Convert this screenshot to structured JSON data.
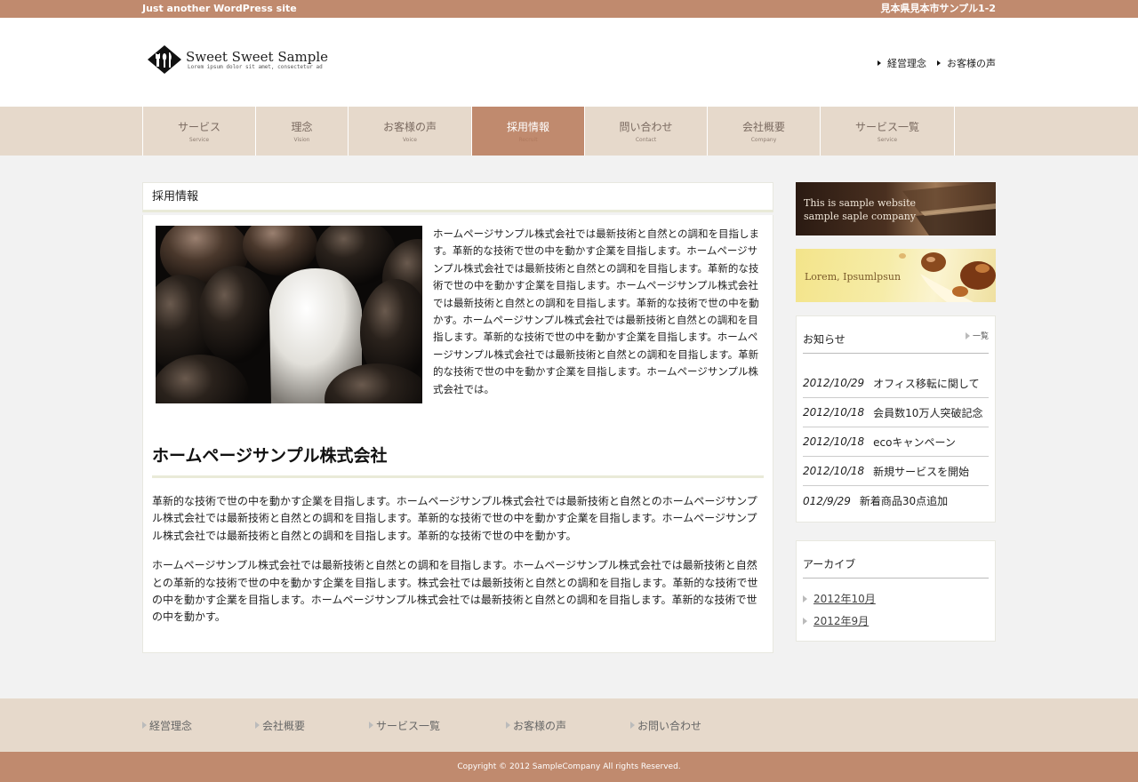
{
  "topbar": {
    "tagline": "Just another WordPress site",
    "address": "見本県見本市サンプル1-2"
  },
  "logo": {
    "title": "Sweet Sweet Sample",
    "subtitle": "Lorem ipsum dolor sit amet, consectetur ad"
  },
  "header_links": [
    {
      "label": "経営理念"
    },
    {
      "label": "お客様の声"
    }
  ],
  "nav": [
    {
      "jp": "サービス",
      "en": "Service",
      "active": false
    },
    {
      "jp": "理念",
      "en": "Vision",
      "active": false
    },
    {
      "jp": "お客様の声",
      "en": "Voice",
      "active": false
    },
    {
      "jp": "採用情報",
      "en": "Recruit",
      "active": true
    },
    {
      "jp": "問い合わせ",
      "en": "Contact",
      "active": false
    },
    {
      "jp": "会社概要",
      "en": "Company",
      "active": false
    },
    {
      "jp": "サービス一覧",
      "en": "Service",
      "active": false
    }
  ],
  "page": {
    "title": "採用情報",
    "intro": "ホームページサンプル株式会社では最新技術と自然との調和を目指します。革新的な技術で世の中を動かす企業を目指します。ホームページサンプル株式会社では最新技術と自然との調和を目指します。革新的な技術で世の中を動かす企業を目指します。ホームページサンプル株式会社では最新技術と自然との調和を目指します。革新的な技術で世の中を動かす。ホームページサンプル株式会社では最新技術と自然との調和を目指します。革新的な技術で世の中を動かす企業を目指します。ホームページサンプル株式会社では最新技術と自然との調和を目指します。革新的な技術で世の中を動かす企業を目指します。ホームページサンプル株式会社では。",
    "heading": "ホームページサンプル株式会社",
    "para1": "革新的な技術で世の中を動かす企業を目指します。ホームページサンプル株式会社では最新技術と自然とのホームページサンプル株式会社では最新技術と自然との調和を目指します。革新的な技術で世の中を動かす企業を目指します。ホームページサンプル株式会社では最新技術と自然との調和を目指します。革新的な技術で世の中を動かす。",
    "para2": "ホームページサンプル株式会社では最新技術と自然との調和を目指します。ホームページサンプル株式会社では最新技術と自然との革新的な技術で世の中を動かす企業を目指します。株式会社では最新技術と自然との調和を目指します。革新的な技術で世の中を動かす企業を目指します。ホームページサンプル株式会社では最新技術と自然との調和を目指します。革新的な技術で世の中を動かす。"
  },
  "sidebar": {
    "banner1_line1": "This is sample website",
    "banner1_line2": "sample saple company",
    "banner2": "Lorem, Ipsumlpsun",
    "news_title": "お知らせ",
    "news_more": "一覧",
    "news": [
      {
        "date": "2012/10/29",
        "text": "オフィス移転に関して"
      },
      {
        "date": "2012/10/18",
        "text": "会員数10万人突破記念"
      },
      {
        "date": "2012/10/18",
        "text": "ecoキャンペーン"
      },
      {
        "date": "2012/10/18",
        "text": "新規サービスを開始"
      },
      {
        "date": "012/9/29",
        "text": "新着商品30点追加"
      }
    ],
    "archive_title": "アーカイブ",
    "archives": [
      {
        "label": "2012年10月"
      },
      {
        "label": "2012年9月"
      }
    ]
  },
  "footer_nav": [
    {
      "label": "経営理念"
    },
    {
      "label": "会社概要"
    },
    {
      "label": "サービス一覧"
    },
    {
      "label": "お客様の声"
    },
    {
      "label": "お問い合わせ"
    }
  ],
  "copyright": "Copyright © 2012 SampleCompany All rights Reserved.",
  "colors": {
    "accent": "#c08a6e",
    "nav_bg": "#e6d9cb",
    "page_bg": "#f2f2f2"
  },
  "icons": [
    "logo-mark-icon",
    "triangle-bullet-icon"
  ]
}
